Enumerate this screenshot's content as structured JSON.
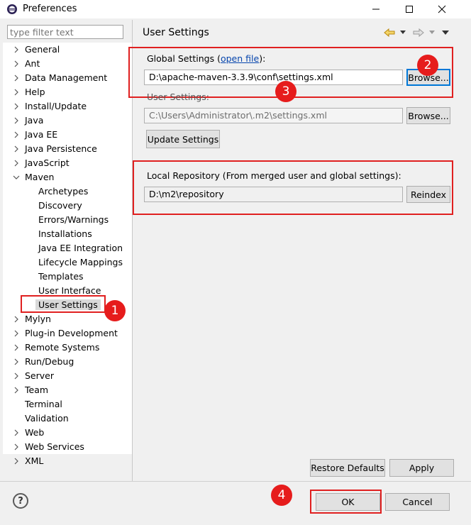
{
  "window": {
    "title": "Preferences",
    "controls": [
      "minimize-icon",
      "maximize-icon",
      "close-icon"
    ]
  },
  "sidebar": {
    "filter_placeholder": "type filter text",
    "items": [
      {
        "label": "General",
        "expandable": true
      },
      {
        "label": "Ant",
        "expandable": true
      },
      {
        "label": "Data Management",
        "expandable": true
      },
      {
        "label": "Help",
        "expandable": true
      },
      {
        "label": "Install/Update",
        "expandable": true
      },
      {
        "label": "Java",
        "expandable": true
      },
      {
        "label": "Java EE",
        "expandable": true
      },
      {
        "label": "Java Persistence",
        "expandable": true
      },
      {
        "label": "JavaScript",
        "expandable": true
      },
      {
        "label": "Maven",
        "expanded": true
      },
      {
        "label": "Archetypes",
        "child": true
      },
      {
        "label": "Discovery",
        "child": true
      },
      {
        "label": "Errors/Warnings",
        "child": true
      },
      {
        "label": "Installations",
        "child": true
      },
      {
        "label": "Java EE Integration",
        "child": true
      },
      {
        "label": "Lifecycle Mappings",
        "child": true
      },
      {
        "label": "Templates",
        "child": true
      },
      {
        "label": "User Interface",
        "child": true
      },
      {
        "label": "User Settings",
        "child": true,
        "selected": true
      },
      {
        "label": "Mylyn",
        "expandable": true
      },
      {
        "label": "Plug-in Development",
        "expandable": true
      },
      {
        "label": "Remote Systems",
        "expandable": true
      },
      {
        "label": "Run/Debug",
        "expandable": true
      },
      {
        "label": "Server",
        "expandable": true
      },
      {
        "label": "Team",
        "expandable": true
      },
      {
        "label": "Terminal"
      },
      {
        "label": "Validation"
      },
      {
        "label": "Web",
        "expandable": true
      },
      {
        "label": "Web Services",
        "expandable": true
      },
      {
        "label": "XML",
        "expandable": true
      }
    ]
  },
  "main": {
    "title": "User Settings",
    "global_settings": {
      "label_prefix": "Global Settings (",
      "link": "open file",
      "label_suffix": "):",
      "value": "D:\\apache-maven-3.3.9\\conf\\settings.xml",
      "browse": "Browse..."
    },
    "user_settings": {
      "label": "User Settings:",
      "value": "C:\\Users\\Administrator\\.m2\\settings.xml",
      "browse": "Browse..."
    },
    "update_button": "Update Settings",
    "local_repo": {
      "label": "Local Repository (From merged user and global settings):",
      "value": "D:\\m2\\repository",
      "reindex": "Reindex"
    },
    "restore_defaults": "Restore Defaults",
    "apply": "Apply"
  },
  "footer": {
    "help_glyph": "?",
    "ok": "OK",
    "cancel": "Cancel"
  },
  "annotations": [
    "1",
    "2",
    "3",
    "4"
  ],
  "colors": {
    "annotation_red": "#e02020",
    "selection": "#d9d9d9",
    "focus_blue": "#0078d7"
  }
}
